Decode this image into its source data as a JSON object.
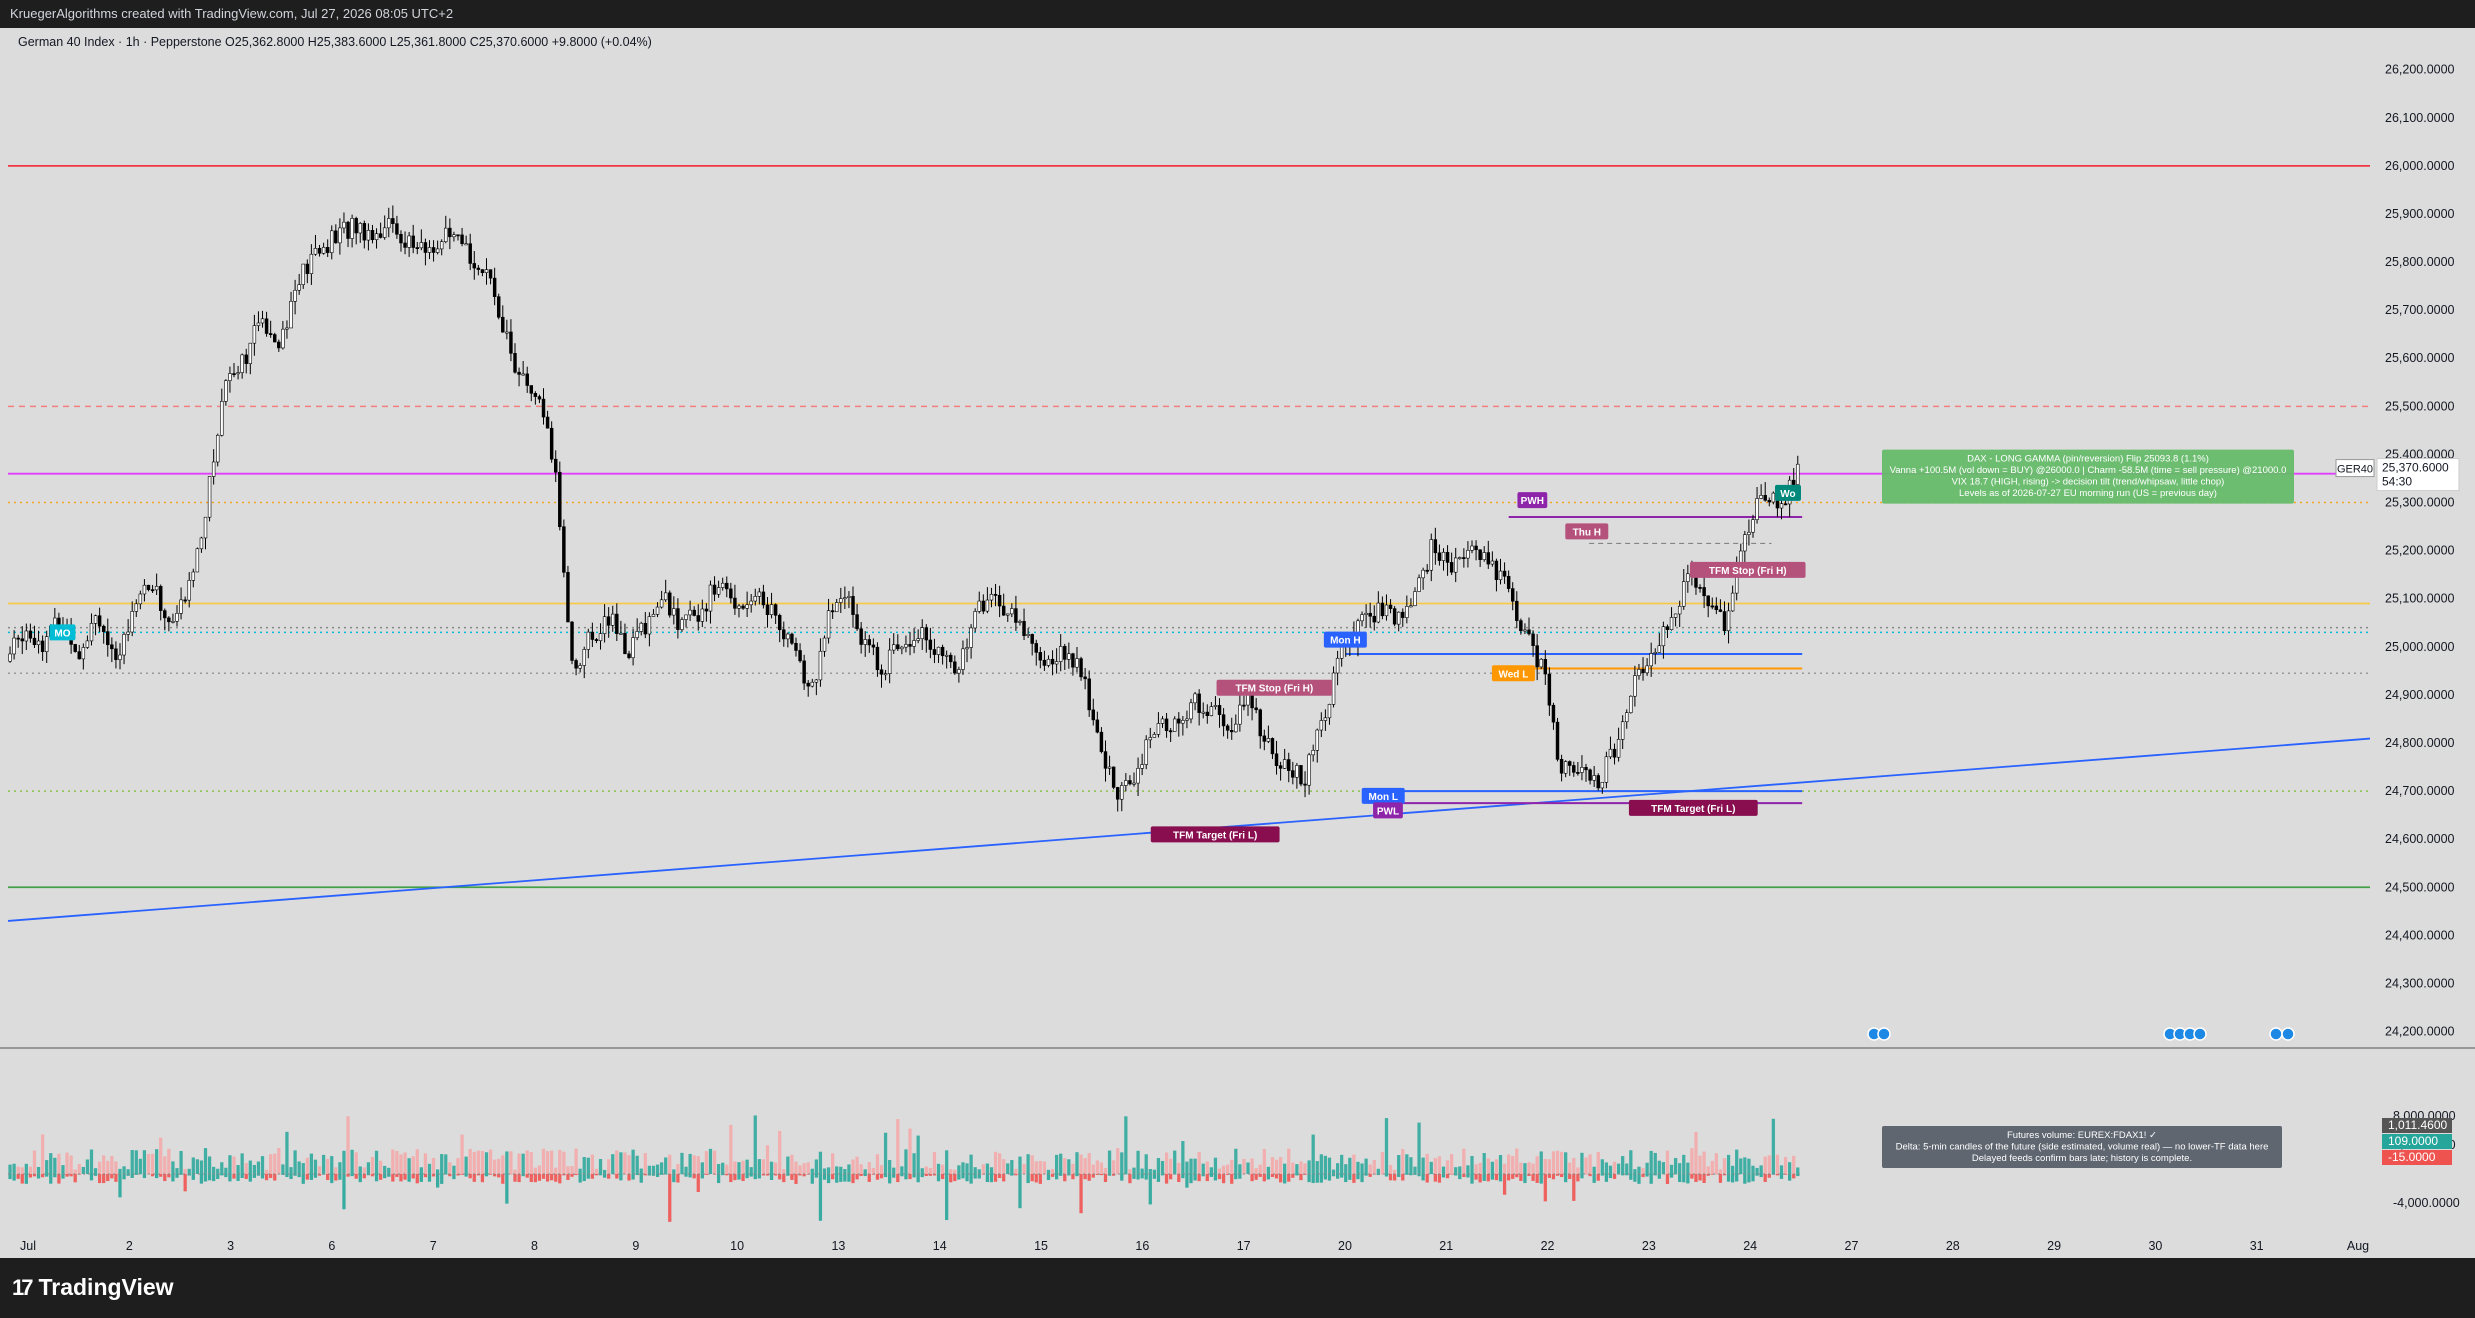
{
  "header": {
    "credit": "KruegerAlgorithms created with TradingView.com, Jul 27, 2026 08:05 UTC+2"
  },
  "legend": {
    "text": "German 40 Index · 1h · Pepperstone  O25,362.8000  H25,383.6000  L25,361.8000  C25,370.6000  +9.8000 (+0.04%)"
  },
  "brand": {
    "name": "TradingView",
    "icon": "tradingview-logo-icon"
  },
  "chart_data": {
    "type": "candlestick",
    "symbol": "GER40",
    "timeframe": "1h",
    "x_dates": [
      "Jul",
      "2",
      "3",
      "6",
      "7",
      "8",
      "9",
      "10",
      "13",
      "14",
      "15",
      "16",
      "17",
      "20",
      "21",
      "22",
      "23",
      "24",
      "27",
      "28",
      "29",
      "30",
      "31",
      "Aug"
    ],
    "ylim": [
      24170,
      26270
    ],
    "y_ticks": [
      24200,
      24300,
      24400,
      24500,
      24600,
      24700,
      24800,
      24900,
      25000,
      25100,
      25200,
      25300,
      25400,
      25500,
      25600,
      25700,
      25800,
      25900,
      26000,
      26100,
      26200
    ],
    "y_tick_labels": [
      "24,200.0000",
      "24,300.0000",
      "24,400.0000",
      "24,500.0000",
      "24,600.0000",
      "24,700.0000",
      "24,800.0000",
      "24,900.0000",
      "25,000.0000",
      "25,100.0000",
      "25,200.0000",
      "25,300.0000",
      "25,400.0000",
      "25,500.0000",
      "25,600.0000",
      "25,700.0000",
      "25,800.0000",
      "25,900.0000",
      "26,000.0000",
      "26,100.0000",
      "26,200.0000"
    ],
    "last_price": 25370.6,
    "last_price_label": "25,370.6000",
    "countdown": "54:30",
    "price_path": [
      [
        0,
        24970
      ],
      [
        1,
        25040
      ],
      [
        2,
        25010
      ],
      [
        3,
        25060
      ],
      [
        4,
        24990
      ],
      [
        5,
        25080
      ],
      [
        6,
        24950
      ],
      [
        7,
        25100
      ],
      [
        8,
        25130
      ],
      [
        9,
        25040
      ],
      [
        10,
        25120
      ],
      [
        11,
        25300
      ],
      [
        12,
        25560
      ],
      [
        13,
        25600
      ],
      [
        14,
        25680
      ],
      [
        15,
        25640
      ],
      [
        16,
        25760
      ],
      [
        17,
        25820
      ],
      [
        18,
        25850
      ],
      [
        19,
        25880
      ],
      [
        20,
        25860
      ],
      [
        21,
        25880
      ],
      [
        22,
        25840
      ],
      [
        23,
        25820
      ],
      [
        24,
        25850
      ],
      [
        25,
        25830
      ],
      [
        26,
        25790
      ],
      [
        27,
        25700
      ],
      [
        28,
        25560
      ],
      [
        29,
        25520
      ],
      [
        30,
        25380
      ],
      [
        31,
        24950
      ],
      [
        32,
        25020
      ],
      [
        33,
        25060
      ],
      [
        34,
        24990
      ],
      [
        35,
        25050
      ],
      [
        36,
        25100
      ],
      [
        37,
        25040
      ],
      [
        38,
        25080
      ],
      [
        39,
        25130
      ],
      [
        40,
        25090
      ],
      [
        41,
        25110
      ],
      [
        42,
        25070
      ],
      [
        43,
        25000
      ],
      [
        44,
        24900
      ],
      [
        45,
        25060
      ],
      [
        46,
        25110
      ],
      [
        47,
        25000
      ],
      [
        48,
        24960
      ],
      [
        49,
        25010
      ],
      [
        50,
        25040
      ],
      [
        51,
        24980
      ],
      [
        52,
        24950
      ],
      [
        53,
        25070
      ],
      [
        54,
        25110
      ],
      [
        55,
        25060
      ],
      [
        56,
        25020
      ],
      [
        57,
        24960
      ],
      [
        58,
        25000
      ],
      [
        59,
        24920
      ],
      [
        60,
        24760
      ],
      [
        61,
        24690
      ],
      [
        62,
        24760
      ],
      [
        63,
        24830
      ],
      [
        64,
        24840
      ],
      [
        65,
        24880
      ],
      [
        66,
        24870
      ],
      [
        67,
        24820
      ],
      [
        68,
        24900
      ],
      [
        69,
        24790
      ],
      [
        70,
        24750
      ],
      [
        71,
        24720
      ],
      [
        72,
        24850
      ],
      [
        73,
        24980
      ],
      [
        74,
        25040
      ],
      [
        75,
        25080
      ],
      [
        76,
        25050
      ],
      [
        77,
        25100
      ],
      [
        78,
        25210
      ],
      [
        79,
        25160
      ],
      [
        80,
        25220
      ],
      [
        81,
        25180
      ],
      [
        82,
        25130
      ],
      [
        83,
        25030
      ],
      [
        84,
        24960
      ],
      [
        85,
        24760
      ],
      [
        86,
        24730
      ],
      [
        87,
        24720
      ],
      [
        88,
        24780
      ],
      [
        89,
        24930
      ],
      [
        90,
        24990
      ],
      [
        91,
        25060
      ],
      [
        92,
        25140
      ],
      [
        93,
        25110
      ],
      [
        94,
        25050
      ],
      [
        95,
        25220
      ],
      [
        96,
        25330
      ],
      [
        97,
        25290
      ],
      [
        98,
        25370
      ]
    ],
    "levels": [
      {
        "price": 26000,
        "color": "#f23645",
        "style": "solid"
      },
      {
        "price": 25500,
        "color": "#f08080",
        "style": "dashed"
      },
      {
        "price": 25360,
        "color": "#e040fb",
        "style": "solid"
      },
      {
        "price": 25300,
        "color": "#f5a623",
        "style": "dotted"
      },
      {
        "price": 25090,
        "color": "#f7c948",
        "style": "solid"
      },
      {
        "price": 25030,
        "color": "#00bcd4",
        "style": "dotted"
      },
      {
        "price": 25040,
        "color": "#888888",
        "style": "dotted"
      },
      {
        "price": 24945,
        "color": "#999999",
        "style": "dotted"
      },
      {
        "price": 24700,
        "color": "#8bc34a",
        "style": "dotted"
      },
      {
        "price": 24500,
        "color": "#43a047",
        "style": "solid"
      }
    ],
    "segments": [
      {
        "x1": 0.634,
        "x2": 0.758,
        "price": 25270,
        "color": "#8e24aa",
        "width": 2
      },
      {
        "x1": 0.565,
        "x2": 0.758,
        "price": 24985,
        "color": "#2962ff",
        "width": 2
      },
      {
        "x1": 0.631,
        "x2": 0.758,
        "price": 24955,
        "color": "#ff9800",
        "width": 2
      },
      {
        "x1": 0.582,
        "x2": 0.758,
        "price": 24700,
        "color": "#2962ff",
        "width": 2
      },
      {
        "x1": 0.582,
        "x2": 0.758,
        "price": 24675,
        "color": "#8e24aa",
        "width": 2
      },
      {
        "x1": 0.668,
        "x2": 0.745,
        "price": 25215,
        "color": "#777777",
        "width": 1
      }
    ],
    "trendline": {
      "p1": [
        0,
        24430
      ],
      "p2": [
        1,
        24810
      ],
      "color": "#2962ff"
    },
    "labels": [
      {
        "text": "MO",
        "x": 0.023,
        "price": 25030,
        "color": "#00bcd4"
      },
      {
        "text": "TFM Stop (Fri H)",
        "x": 0.535,
        "price": 24915,
        "color": "#b5527c"
      },
      {
        "text": "TFM Target (Fri L)",
        "x": 0.51,
        "price": 24610,
        "color": "#880e4f"
      },
      {
        "text": "Mon H",
        "x": 0.565,
        "price": 25015,
        "color": "#2962ff"
      },
      {
        "text": "Mon L",
        "x": 0.581,
        "price": 24690,
        "color": "#2962ff"
      },
      {
        "text": "PWL",
        "x": 0.583,
        "price": 24660,
        "color": "#8e24aa"
      },
      {
        "text": "PWH",
        "x": 0.644,
        "price": 25305,
        "color": "#8e24aa"
      },
      {
        "text": "Thu H",
        "x": 0.667,
        "price": 25240,
        "color": "#b5527c"
      },
      {
        "text": "Wed L",
        "x": 0.636,
        "price": 24945,
        "color": "#ff9800"
      },
      {
        "text": "TFM Stop (Fri H)",
        "x": 0.735,
        "price": 25160,
        "color": "#b5527c"
      },
      {
        "text": "TFM Target (Fri L)",
        "x": 0.712,
        "price": 24665,
        "color": "#880e4f"
      },
      {
        "text": "Wo",
        "x": 0.752,
        "price": 25320,
        "color": "#00897b"
      }
    ],
    "gamma_box": {
      "lines": [
        "DAX - LONG GAMMA (pin/reversion)  Flip 25093.8 (1.1%)",
        "Vanna +100.5M (vol down = BUY) @26000.0  |  Charm -58.5M (time = sell pressure) @21000.0",
        "VIX 18.7 (HIGH, rising) -> decision tilt (trend/whipsaw, little chop)",
        "Levels as of 2026-07-27 EU morning run (US = previous day)"
      ],
      "color": "#66bb6a"
    },
    "volume": {
      "y_tick_labels": [
        "8,000.0000",
        "4,000.0000",
        "-4,000.0000"
      ],
      "y_ticks": [
        8000,
        4000,
        -4000
      ],
      "ylim": [
        -9000,
        10000
      ],
      "value_label": "1,011.4600",
      "buy_label": "109.0000",
      "sell_label": "-15.0000",
      "info_lines": [
        "Futures volume: EUREX:FDAX1! ✓",
        "Delta: 5-min candles of the future (side estimated, volume real) — no lower-TF data here",
        "Delayed feeds confirm bars late; history is complete."
      ]
    },
    "colors": {
      "up": "#ffffff",
      "down": "#000000",
      "vol_up": "#26a69a",
      "vol_down": "#ef5350",
      "bg": "#dcdcdc"
    }
  }
}
